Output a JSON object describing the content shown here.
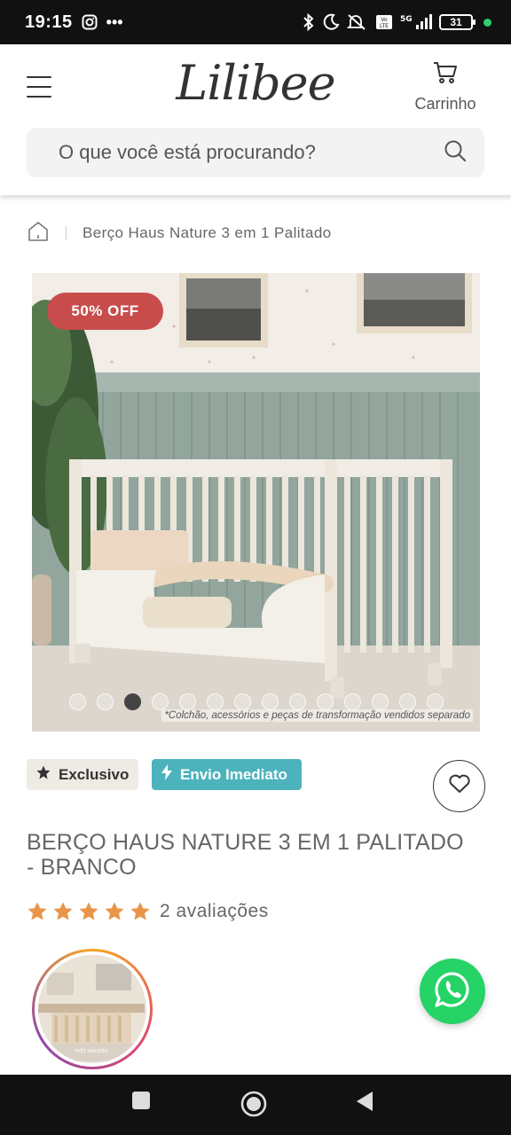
{
  "status_bar": {
    "time": "19:15",
    "battery": "31",
    "icons": [
      "instagram-icon",
      "more-icon",
      "bluetooth-icon",
      "moon-icon",
      "mute-icon",
      "volte-icon",
      "signal-5g-icon",
      "battery-icon"
    ]
  },
  "header": {
    "logo": "Lilibee",
    "cart_label": "Carrinho",
    "search_placeholder": "O que você está procurando?"
  },
  "breadcrumb": {
    "current": "Berço Haus Nature 3 em 1 Palitado"
  },
  "product": {
    "discount_badge": "50% OFF",
    "image_disclaimer": "*Colchão, acessórios e peças de transformação vendidos separado",
    "carousel_total": 14,
    "carousel_active": 3,
    "tags": {
      "exclusive": "Exclusivo",
      "shipping": "Envio Imediato"
    },
    "title": "BERÇO HAUS NATURE 3 EM 1 PALITADO - BRANCO",
    "rating_stars": 5,
    "reviews": "2 avaliações",
    "story_caption": "TRÊS VERSÕES"
  },
  "colors": {
    "discount": "#c94c4c",
    "shipping_tag": "#4cb3bc",
    "exclusive_tag": "#eeeae4",
    "star": "#e8954a",
    "whatsapp": "#25d366"
  }
}
